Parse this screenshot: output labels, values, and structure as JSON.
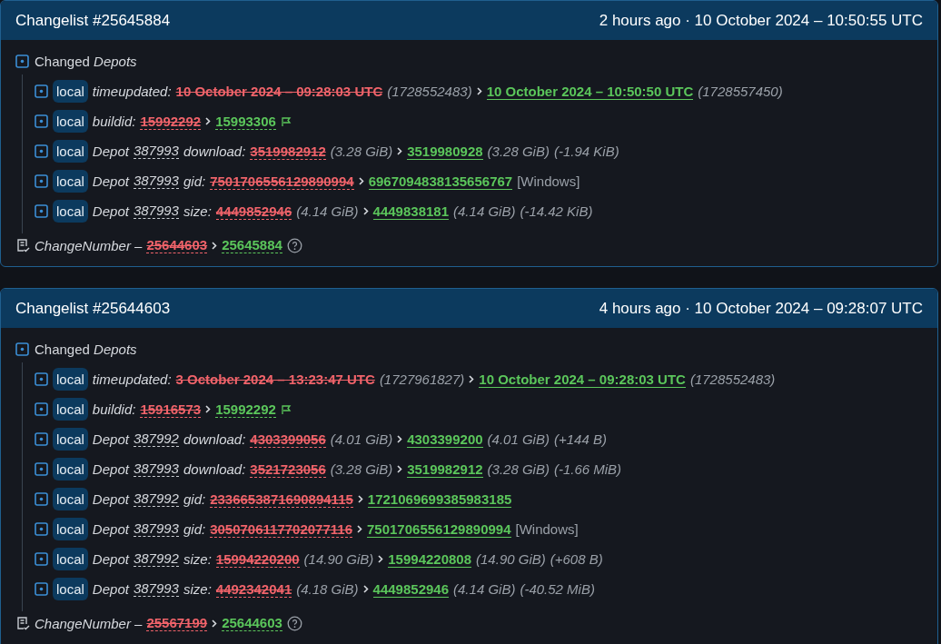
{
  "changelists": [
    {
      "title": "Changelist #25645884",
      "time": "2 hours ago · 10 October 2024 – 10:50:55 UTC",
      "section": {
        "label": "Changed",
        "label_em": "Depots"
      },
      "rows": [
        {
          "kind": "time",
          "badge": "local",
          "key": "timeupdated:",
          "old": "10 October 2024 – 09:28:03 UTC",
          "old_note": "(1728552483)",
          "new": "10 October 2024 – 10:50:50 UTC",
          "new_note": "(1728557450)"
        },
        {
          "kind": "build",
          "badge": "local",
          "key": "buildid:",
          "old": "15992292",
          "new": "15993306"
        },
        {
          "kind": "value",
          "badge": "local",
          "prefix": "Depot",
          "depot": "387993",
          "key": "download:",
          "old": "3519982912",
          "old_note": "(3.28 GiB)",
          "new": "3519980928",
          "new_note": "(3.28 GiB)",
          "extra": "(-1.94 KiB)"
        },
        {
          "kind": "value",
          "badge": "local",
          "prefix": "Depot",
          "depot": "387993",
          "key": "gid:",
          "old": "7501706556129890994",
          "new": "6967094838135656767",
          "platform": "[Windows]"
        },
        {
          "kind": "value",
          "badge": "local",
          "prefix": "Depot",
          "depot": "387993",
          "key": "size:",
          "old": "4449852946",
          "old_note": "(4.14 GiB)",
          "new": "4449838181",
          "new_note": "(4.14 GiB)",
          "extra": "(-14.42 KiB)"
        }
      ],
      "change_number": {
        "label": "ChangeNumber –",
        "old": "25644603",
        "new": "25645884"
      }
    },
    {
      "title": "Changelist #25644603",
      "time": "4 hours ago · 10 October 2024 – 09:28:07 UTC",
      "section": {
        "label": "Changed",
        "label_em": "Depots"
      },
      "rows": [
        {
          "kind": "time",
          "badge": "local",
          "key": "timeupdated:",
          "old": "3 October 2024 – 13:23:47 UTC",
          "old_note": "(1727961827)",
          "new": "10 October 2024 – 09:28:03 UTC",
          "new_note": "(1728552483)"
        },
        {
          "kind": "build",
          "badge": "local",
          "key": "buildid:",
          "old": "15916573",
          "new": "15992292"
        },
        {
          "kind": "value",
          "badge": "local",
          "prefix": "Depot",
          "depot": "387992",
          "key": "download:",
          "old": "4303399056",
          "old_note": "(4.01 GiB)",
          "new": "4303399200",
          "new_note": "(4.01 GiB)",
          "extra": "(+144 B)"
        },
        {
          "kind": "value",
          "badge": "local",
          "prefix": "Depot",
          "depot": "387993",
          "key": "download:",
          "old": "3521723056",
          "old_note": "(3.28 GiB)",
          "new": "3519982912",
          "new_note": "(3.28 GiB)",
          "extra": "(-1.66 MiB)"
        },
        {
          "kind": "value",
          "badge": "local",
          "prefix": "Depot",
          "depot": "387992",
          "key": "gid:",
          "old": "2336653871690894115",
          "new": "1721069699385983185"
        },
        {
          "kind": "value",
          "badge": "local",
          "prefix": "Depot",
          "depot": "387993",
          "key": "gid:",
          "old": "3050706117702077116",
          "new": "7501706556129890994",
          "platform": "[Windows]"
        },
        {
          "kind": "value",
          "badge": "local",
          "prefix": "Depot",
          "depot": "387992",
          "key": "size:",
          "old": "15994220200",
          "old_note": "(14.90 GiB)",
          "new": "15994220808",
          "new_note": "(14.90 GiB)",
          "extra": "(+608 B)"
        },
        {
          "kind": "value",
          "badge": "local",
          "prefix": "Depot",
          "depot": "387993",
          "key": "size:",
          "old": "4492342041",
          "old_note": "(4.18 GiB)",
          "new": "4449852946",
          "new_note": "(4.14 GiB)",
          "extra": "(-40.52 MiB)"
        }
      ],
      "change_number": {
        "label": "ChangeNumber –",
        "old": "25567199",
        "new": "25644603"
      }
    }
  ]
}
